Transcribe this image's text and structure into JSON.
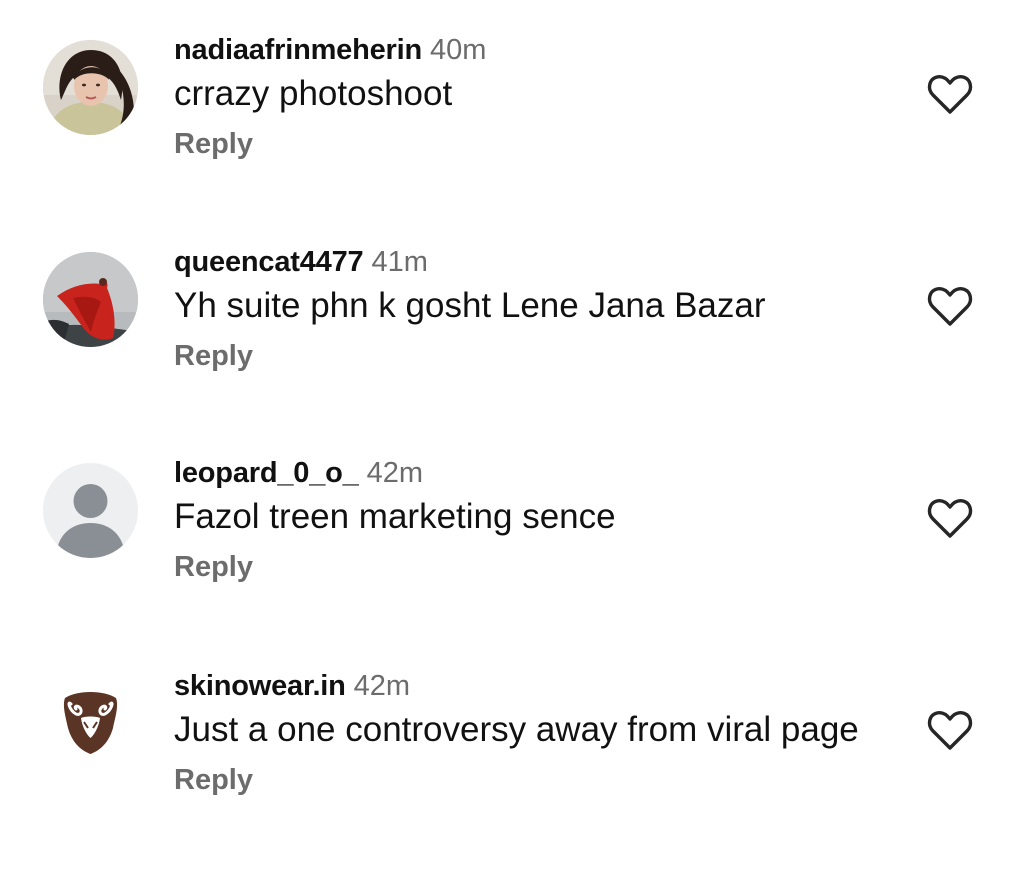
{
  "comments": [
    {
      "username": "nadiaafrinmeherin",
      "time": "40m",
      "text": "crrazy photoshoot",
      "reply_label": "Reply",
      "avatar": "profile-photo"
    },
    {
      "username": "queencat4477",
      "time": "41m",
      "text": "Yh suite phn k gosht Lene Jana Bazar",
      "reply_label": "Reply",
      "avatar": "red-dress-photo"
    },
    {
      "username": "leopard_0_o_",
      "time": "42m",
      "text": "Fazol treen marketing sence",
      "reply_label": "Reply",
      "avatar": "default-user-silhouette"
    },
    {
      "username": "skinowear.in",
      "time": "42m",
      "text": "Just a one controversy away from viral page",
      "reply_label": "Reply",
      "avatar": "ram-head-logo"
    }
  ],
  "colors": {
    "text": "#111111",
    "secondary_text": "#6c6c6c",
    "placeholder_avatar_bg": "#eeeff1",
    "placeholder_avatar_fg": "#8a8f96",
    "logo_brown": "#5a3424"
  },
  "icons": {
    "like": "heart-outline-icon"
  }
}
